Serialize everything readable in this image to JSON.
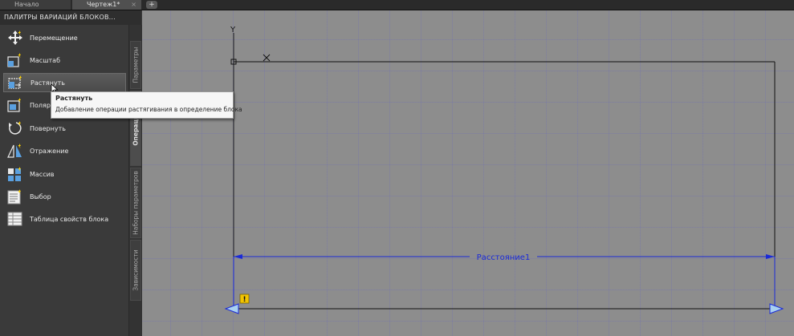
{
  "tabs": {
    "start_label": "Начало",
    "drawing_label": "Чертеж1*",
    "close_glyph": "×",
    "add_glyph": "+"
  },
  "palette": {
    "title": "ПАЛИТРЫ ВАРИАЦИЙ БЛОКОВ...",
    "tools": [
      {
        "label": "Перемещение",
        "icon": "move-icon"
      },
      {
        "label": "Масштаб",
        "icon": "scale-icon"
      },
      {
        "label": "Растянуть",
        "icon": "stretch-icon",
        "active": true
      },
      {
        "label": "Полярное растягивание",
        "visible_label": "Полярн",
        "icon": "polar-stretch-icon"
      },
      {
        "label": "Повернуть",
        "icon": "rotate-icon"
      },
      {
        "label": "Отражение",
        "icon": "flip-icon"
      },
      {
        "label": "Массив",
        "icon": "array-icon"
      },
      {
        "label": "Выбор",
        "icon": "lookup-icon"
      },
      {
        "label": "Таблица свойств блока",
        "icon": "block-table-icon"
      }
    ],
    "side_tabs": [
      "Параметры",
      "Операции",
      "Наборы параметров",
      "Зависимости"
    ],
    "active_side_tab": "Операции"
  },
  "tooltip": {
    "title": "Растянуть",
    "description": "Добавление операции растягивания в определение блока"
  },
  "canvas": {
    "axis_y_label": "Y",
    "dimension_label": "Расстояние1",
    "warning_glyph": "!",
    "colors": {
      "background": "#8d8d8d",
      "dimension": "#1a2ad8",
      "rectangle": "#111111",
      "warning_badge": "#f2c400"
    }
  }
}
